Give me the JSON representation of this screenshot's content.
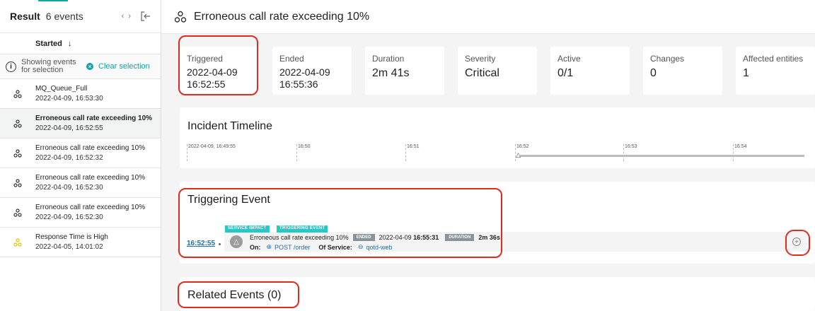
{
  "sidebar": {
    "title": "Result",
    "count": "6 events",
    "nav_prev": "‹",
    "nav_next": "›",
    "sort_label": "Started",
    "sort_arrow": "↓",
    "info_text": "Showing events for selection",
    "clear_selection": "Clear selection",
    "events": [
      {
        "name": "MQ_Queue_Full",
        "time": "2022-04-09, 16:53:30",
        "color": "#333333"
      },
      {
        "name": "Erroneous call rate exceeding 10%",
        "time": "2022-04-09, 16:52:55",
        "color": "#333333",
        "selected": true
      },
      {
        "name": "Erroneous call rate exceeding 10%",
        "time": "2022-04-09, 16:52:32",
        "color": "#333333"
      },
      {
        "name": "Erroneous call rate exceeding 10%",
        "time": "2022-04-09, 16:52:30",
        "color": "#333333"
      },
      {
        "name": "Erroneous call rate exceeding 10%",
        "time": "2022-04-09, 16:52:30",
        "color": "#333333"
      },
      {
        "name": "Response Time is High",
        "time": "2022-04-05, 14:01:02",
        "color": "#e6c200"
      }
    ]
  },
  "header": {
    "title": "Erroneous call rate exceeding 10%",
    "icon": "incident-icon"
  },
  "stats": {
    "triggered": {
      "label": "Triggered",
      "line1": "2022-04-09",
      "line2": "16:52:55"
    },
    "ended": {
      "label": "Ended",
      "line1": "2022-04-09",
      "line2": "16:55:36"
    },
    "duration": {
      "label": "Duration",
      "value": "2m 41s"
    },
    "severity": {
      "label": "Severity",
      "value": "Critical"
    },
    "active": {
      "label": "Active",
      "value": "0/1"
    },
    "changes": {
      "label": "Changes",
      "value": "0"
    },
    "affected": {
      "label": "Affected entities",
      "value": "1"
    }
  },
  "timeline": {
    "title": "Incident Timeline",
    "ticks": [
      "2022-04-09, 16:49:55",
      "16:50",
      "16:51",
      "16:52",
      "16:53",
      "16:54"
    ]
  },
  "triggering": {
    "title": "Triggering Event",
    "time": "16:52:55",
    "badge1": "SERVICE IMPACT",
    "badge2": "TRIGGERING EVENT",
    "event_name": "Erroneous call rate exceeding 10%",
    "ended_pill": "ENDED",
    "ended_date": "2022-04-09",
    "ended_time": "16:55:31",
    "duration_pill": "DURATION",
    "duration_value": "2m 36s",
    "on_label": "On:",
    "endpoint": "POST /order",
    "service_label": "Of Service:",
    "service": "qotd-web",
    "expand": "+"
  },
  "related": {
    "title": "Related Events (0)"
  },
  "colors": {
    "accent": "#13a0a0",
    "highlight": "#e02b1d",
    "link": "#1f6fa8",
    "warning": "#e6c200"
  }
}
